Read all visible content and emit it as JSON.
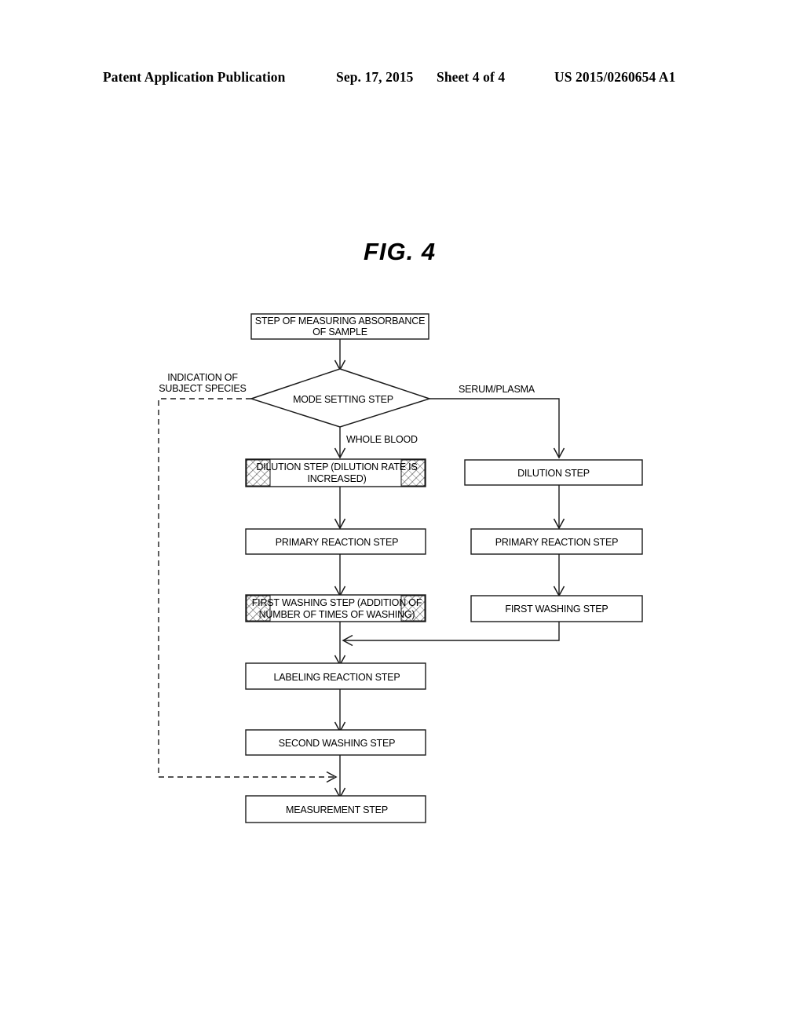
{
  "header": {
    "publication": "Patent Application Publication",
    "date": "Sep. 17, 2015",
    "sheet": "Sheet 4 of 4",
    "number": "US 2015/0260654 A1"
  },
  "figure": {
    "title": "FIG. 4"
  },
  "diagram": {
    "type": "flowchart",
    "nodes": {
      "absorbance": {
        "line1": "STEP OF MEASURING ABSORBANCE",
        "line2": "OF SAMPLE",
        "shape": "rect"
      },
      "mode_setting": {
        "line1": "MODE SETTING STEP",
        "shape": "diamond"
      },
      "wb_dilution": {
        "line1": "DILUTION STEP (DILUTION RATE IS",
        "line2": "INCREASED)",
        "shape": "rect-hatched"
      },
      "wb_primary": {
        "line1": "PRIMARY REACTION STEP",
        "shape": "rect"
      },
      "wb_first_wash": {
        "line1": "FIRST WASHING STEP (ADDITION OF",
        "line2": "NUMBER OF TIMES OF WASHING)",
        "shape": "rect-hatched"
      },
      "sp_dilution": {
        "line1": "DILUTION STEP",
        "shape": "rect"
      },
      "sp_primary": {
        "line1": "PRIMARY REACTION STEP",
        "shape": "rect"
      },
      "sp_first_wash": {
        "line1": "FIRST WASHING STEP",
        "shape": "rect"
      },
      "labeling": {
        "line1": "LABELING REACTION STEP",
        "shape": "rect"
      },
      "second_wash": {
        "line1": "SECOND WASHING STEP",
        "shape": "rect"
      },
      "measurement": {
        "line1": "MEASUREMENT STEP",
        "shape": "rect"
      }
    },
    "edge_labels": {
      "indication_line1": "INDICATION OF",
      "indication_line2": "SUBJECT SPECIES",
      "serum_plasma": "SERUM/PLASMA",
      "whole_blood": "WHOLE BLOOD"
    },
    "colors": {
      "stroke": "#1a1a1a",
      "fill": "#ffffff",
      "hatch": "#555555"
    }
  }
}
